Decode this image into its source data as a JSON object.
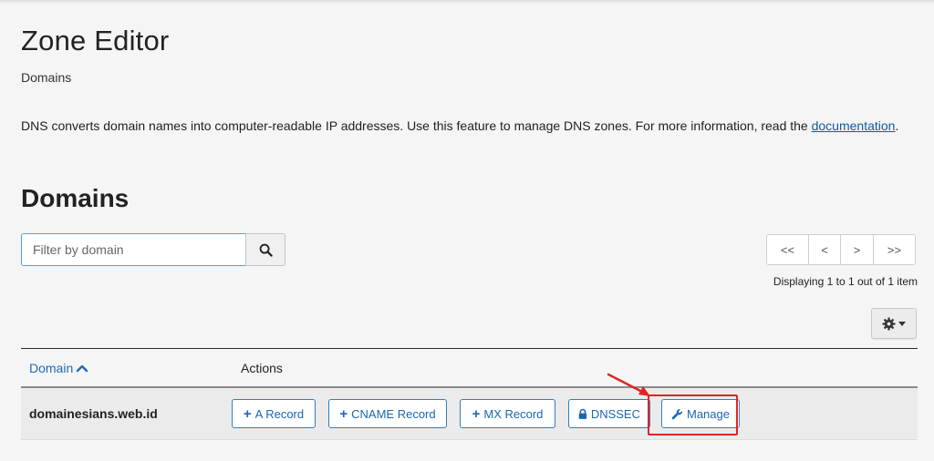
{
  "header": {
    "title": "Zone Editor",
    "breadcrumb": "Domains"
  },
  "description": {
    "text": "DNS converts domain names into computer-readable IP addresses. Use this feature to manage DNS zones. For more information, read the ",
    "link_text": "documentation",
    "suffix": "."
  },
  "section": {
    "heading": "Domains"
  },
  "filter": {
    "placeholder": "Filter by domain",
    "value": ""
  },
  "pagination": {
    "first": "<<",
    "prev": "<",
    "next": ">",
    "last": ">>",
    "display_text": "Displaying 1 to 1 out of 1 item"
  },
  "table": {
    "columns": {
      "domain": "Domain",
      "actions": "Actions"
    },
    "sort": "ascending",
    "rows": [
      {
        "domain": "domainesians.web.id",
        "actions": {
          "a_record": "A Record",
          "cname_record": "CNAME Record",
          "mx_record": "MX Record",
          "dnssec": "DNSSEC",
          "manage": "Manage"
        }
      }
    ]
  },
  "icons": {
    "search": "search-icon",
    "settings": "gear-icon",
    "sort": "chevron-up-icon",
    "add": "plus-icon",
    "lock": "lock-icon",
    "wrench": "wrench-icon"
  },
  "colors": {
    "link": "#0d5aa7",
    "button_border": "#2f7ec3",
    "button_text": "#1a66ad",
    "highlight": "#e02424"
  }
}
